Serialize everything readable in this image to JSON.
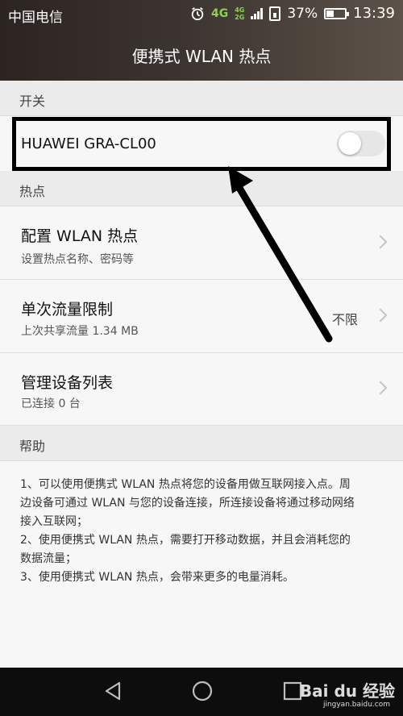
{
  "status_bar": {
    "carrier": "中国电信",
    "network_primary": "4G",
    "network_secondary_top": "4G",
    "network_secondary_bottom": "2G",
    "battery_percent": "37%",
    "time": "13:39"
  },
  "header": {
    "title": "便携式 WLAN 热点"
  },
  "section_switch": {
    "label": "开关"
  },
  "hotspot_toggle_row": {
    "device_name": "HUAWEI GRA-CL00",
    "toggle_on": false
  },
  "section_hotspot": {
    "label": "热点"
  },
  "settings": [
    {
      "title": "配置 WLAN 热点",
      "subtitle": "设置热点名称、密码等",
      "value": ""
    },
    {
      "title": "单次流量限制",
      "subtitle": "上次共享流量 1.34 MB",
      "value": "不限"
    },
    {
      "title": "管理设备列表",
      "subtitle": "已连接 0 台",
      "value": ""
    }
  ],
  "section_help": {
    "label": "帮助"
  },
  "help_lines": [
    "1、可以使用便携式 WLAN 热点将您的设备用做互联网接入点。周",
    "边设备可通过 WLAN 与您的设备连接，所连接设备将通过移动网络",
    "接入互联网；",
    "2、使用便携式 WLAN 热点，需要打开移动数据，并且会消耗您的",
    "数据流量；",
    "3、使用便携式 WLAN 热点，会带来更多的电量消耗。"
  ],
  "watermark": {
    "logo_text": "Bai du 经验",
    "url": "jingyan.baidu.com"
  },
  "icons": {
    "alarm": "alarm-icon",
    "battery": "battery-icon",
    "chevron": "chevron-right-icon",
    "back": "back-triangle-icon",
    "home": "home-circle-icon",
    "recent": "recent-square-icon"
  },
  "colors": {
    "network_badge": "#8fd14f",
    "annotation": "#000000"
  }
}
